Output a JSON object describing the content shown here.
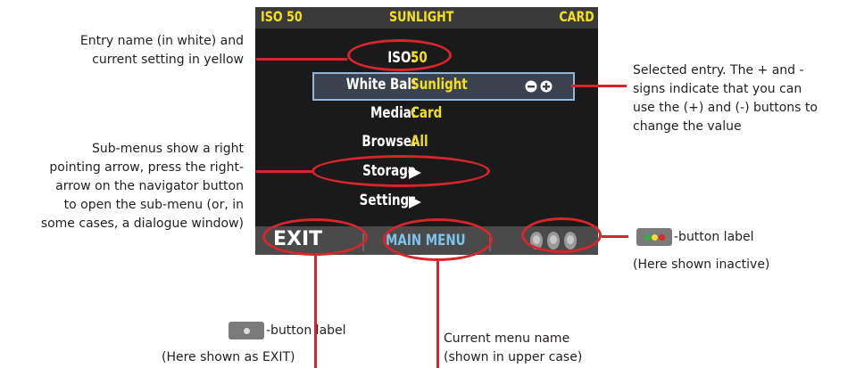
{
  "status_bar": {
    "left": "ISO 50",
    "center": "SUNLIGHT",
    "right": "CARD"
  },
  "menu_rows": [
    {
      "label": "ISO:",
      "value": "50"
    },
    {
      "label": "White Bal:",
      "value": "Sunlight"
    },
    {
      "label": "Media:",
      "value": "Card"
    },
    {
      "label": "Browse:",
      "value": "All"
    },
    {
      "label": "Storage",
      "value": ""
    },
    {
      "label": "Settings",
      "value": ""
    }
  ],
  "bottom_bar": {
    "left": "EXIT",
    "center": "MAIN MENU"
  },
  "annotations": {
    "entry_name": [
      "Entry name (in white) and",
      "current setting in yellow"
    ],
    "submenu": [
      "Sub-menus show a right",
      "pointing arrow, press the right-",
      "arrow on the navigator button",
      "to open the sub-menu (or, in",
      "some cases, a dialogue window)"
    ],
    "selected": [
      "Selected entry. The + and -",
      "signs indicate that you can",
      "use the (+) and (-) buttons to",
      "change the value"
    ],
    "right_button": [
      "-button label",
      "(Here shown inactive)"
    ],
    "left_button": [
      "-button label",
      "(Here shown as EXIT)"
    ],
    "menu_name": [
      "Current menu name",
      "(shown in upper case)"
    ]
  },
  "colors": {
    "highlight": "#d6262b",
    "value": "#f2e01e",
    "menu_name": "#7fc3ec",
    "selection_border": "#8fb8da"
  }
}
